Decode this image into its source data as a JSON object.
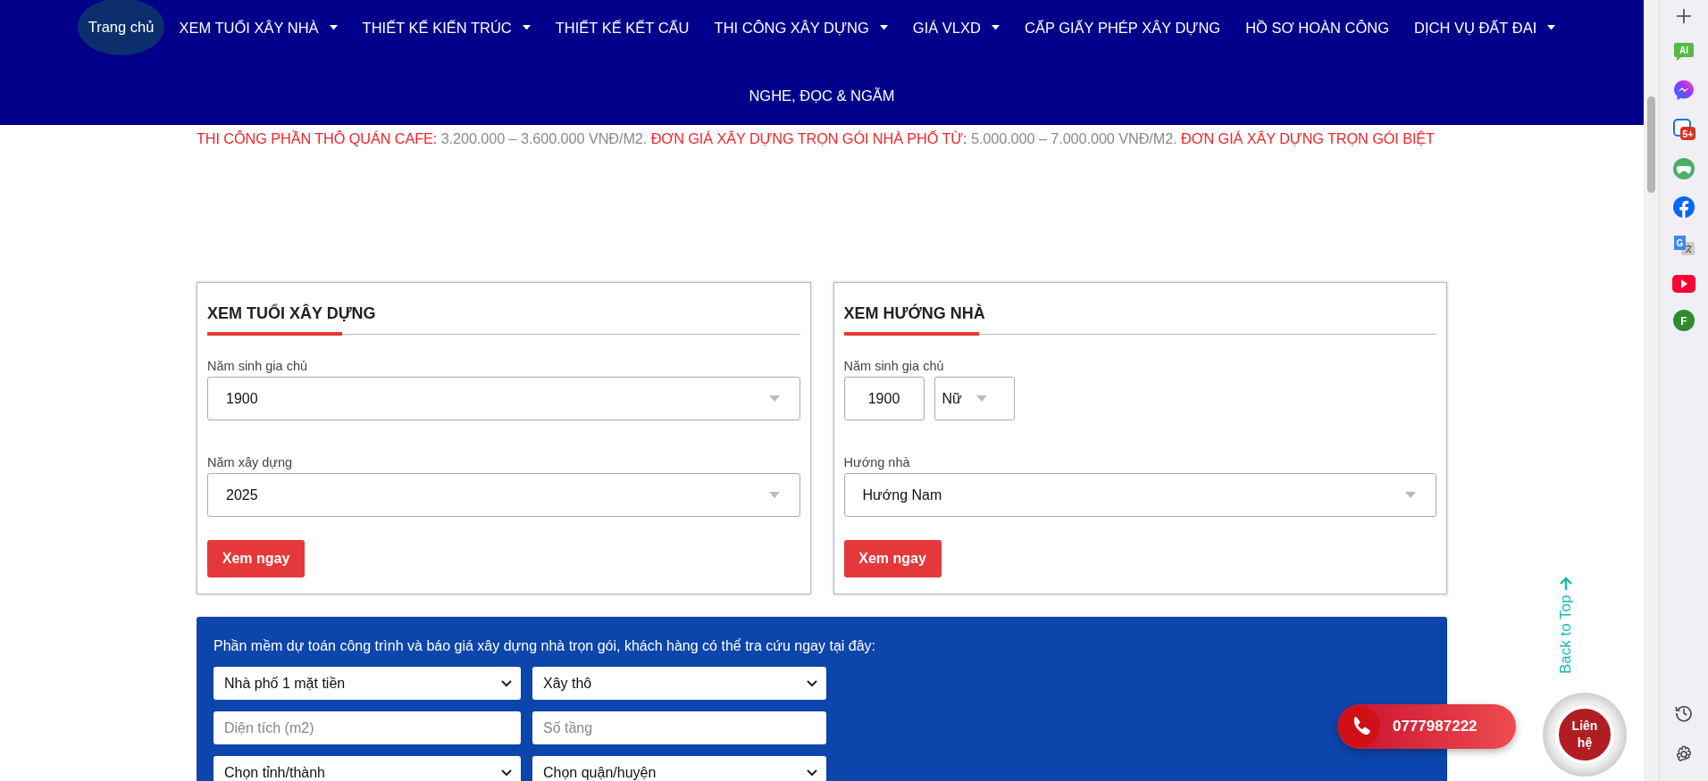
{
  "nav": {
    "items": [
      {
        "label": "Trang chủ",
        "has_dropdown": false,
        "selected": true
      },
      {
        "label": "XEM TUỔI XÂY NHÀ",
        "has_dropdown": true,
        "selected": false
      },
      {
        "label": "THIẾT KẾ KIẾN TRÚC",
        "has_dropdown": true,
        "selected": false
      },
      {
        "label": "THIẾT KẾ KẾT CẤU",
        "has_dropdown": false,
        "selected": false
      },
      {
        "label": "THI CÔNG XÂY DỰNG",
        "has_dropdown": true,
        "selected": false
      },
      {
        "label": "GIÁ VLXD",
        "has_dropdown": true,
        "selected": false
      },
      {
        "label": "CẤP GIẤY PHÉP XÂY DỰNG",
        "has_dropdown": false,
        "selected": false
      },
      {
        "label": "HỒ SƠ HOÀN CÔNG",
        "has_dropdown": false,
        "selected": false
      },
      {
        "label": "DỊCH VỤ ĐẤT ĐAI",
        "has_dropdown": true,
        "selected": false
      },
      {
        "label": "NGHE, ĐỌC & NGẪM",
        "has_dropdown": false,
        "selected": false
      }
    ]
  },
  "ticker": [
    {
      "kind": "label",
      "text": "THI CÔNG PHẦN THÔ QUÁN CAFE:"
    },
    {
      "kind": "value",
      "text": "3.200.000 – 3.600.000 VNĐ/M2."
    },
    {
      "kind": "label",
      "text": "ĐƠN GIÁ XÂY DỰNG TRỌN GÓI NHÀ PHỐ TỪ:"
    },
    {
      "kind": "value",
      "text": "5.000.000 – 7.000.000 VNĐ/M2."
    },
    {
      "kind": "label",
      "text": "ĐƠN GIÁ XÂY DỰNG TRỌN GÓI BIỆT"
    }
  ],
  "cards": [
    {
      "title": "XEM TUỔI XÂY DỰNG",
      "fields": [
        {
          "label": "Năm sinh gia chủ",
          "controls": [
            {
              "kind": "dropdown",
              "value": "1900"
            }
          ]
        },
        {
          "label": "Năm xây dựng",
          "controls": [
            {
              "kind": "dropdown",
              "value": "2025"
            }
          ]
        }
      ],
      "button": "Xem ngay"
    },
    {
      "title": "XEM HƯỚNG NHÀ",
      "fields": [
        {
          "label": "Năm sinh gia chủ",
          "controls": [
            {
              "kind": "input",
              "value": "1900"
            },
            {
              "kind": "dropdown",
              "value": "Nữ"
            }
          ]
        },
        {
          "label": "Hướng nhà",
          "controls": [
            {
              "kind": "dropdown",
              "value": "Hướng Nam"
            }
          ]
        }
      ],
      "button": "Xem ngay"
    }
  ],
  "estimator": {
    "intro": "Phần mềm dự toán công trình và báo giá xây dựng nhà trọn gói, khách hàng có thể tra cứu ngay tại đây:",
    "rows": [
      [
        {
          "kind": "select",
          "value": "Nhà phố 1 mặt tiền"
        },
        {
          "kind": "select",
          "value": "Xây thô"
        }
      ],
      [
        {
          "kind": "input",
          "placeholder": "Diện tích (m2)"
        },
        {
          "kind": "input",
          "placeholder": "Số tầng"
        }
      ],
      [
        {
          "kind": "select",
          "value": "Chọn tỉnh/thành"
        },
        {
          "kind": "select",
          "value": "Chọn quận/huyện"
        }
      ]
    ]
  },
  "floating": {
    "phone": "0777987222",
    "contact": "Liên hệ",
    "back_to_top": "Back to Top"
  },
  "browser_sidebar": {
    "top": [
      {
        "kind": "add"
      },
      {
        "kind": "ai",
        "text": "AI"
      },
      {
        "kind": "messenger"
      },
      {
        "kind": "games-badge",
        "text": "5+"
      },
      {
        "kind": "gamepad"
      },
      {
        "kind": "facebook"
      },
      {
        "kind": "translate",
        "text": "G"
      },
      {
        "kind": "youtube"
      },
      {
        "kind": "profile",
        "text": "F"
      }
    ],
    "bottom": [
      {
        "kind": "history"
      },
      {
        "kind": "settings"
      }
    ]
  }
}
